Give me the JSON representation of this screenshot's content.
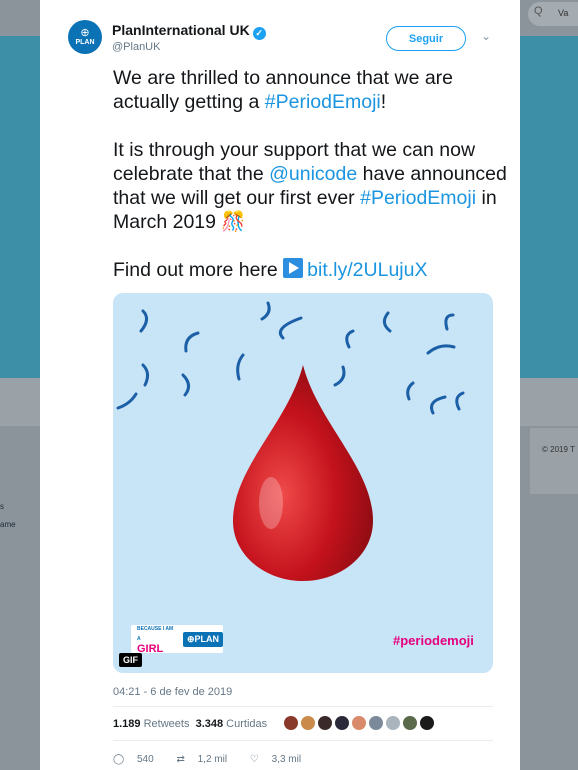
{
  "background": {
    "search_placeholder": "Q",
    "search_text": "Va",
    "copyright": "© 2019 T",
    "side_text_1": "s",
    "side_text_2": "ame"
  },
  "tweet": {
    "author_name": "PlanInternational UK",
    "handle": "@PlanUK",
    "avatar_label": "PLAN",
    "follow_label": "Seguir",
    "line1_pre": "We are thrilled to announce that we are actually getting a ",
    "line1_tag": "#PeriodEmoji",
    "line1_post": "!",
    "line2_pre": "It is through your support that we can now celebrate that the ",
    "line2_mention": "@unicode",
    "line2_mid": " have announced that we will get our first ever ",
    "line2_tag": "#PeriodEmoji",
    "line2_post": " in March 2019 🎊",
    "line3_pre": "Find out more here ",
    "line3_link": "bit.ly/2ULujuX",
    "media_hashtag": "#periodemoji",
    "media_girl": "GIRL",
    "media_girl_small": "BECAUSE I AM A",
    "media_plan": "⊕PLAN",
    "gif_label": "GIF",
    "timestamp": "04:21 - 6 de fev de 2019",
    "retweets_count": "1.189",
    "retweets_label": "Retweets",
    "likes_count": "3.348",
    "likes_label": "Curtidas",
    "reply_count": "540",
    "retweet_action_count": "1,2 mil",
    "like_action_count": "3,3 mil"
  },
  "colors": {
    "accent": "#1da1f2",
    "brand_plan": "#0b72b5",
    "hashtag_pink": "#e6007e"
  }
}
